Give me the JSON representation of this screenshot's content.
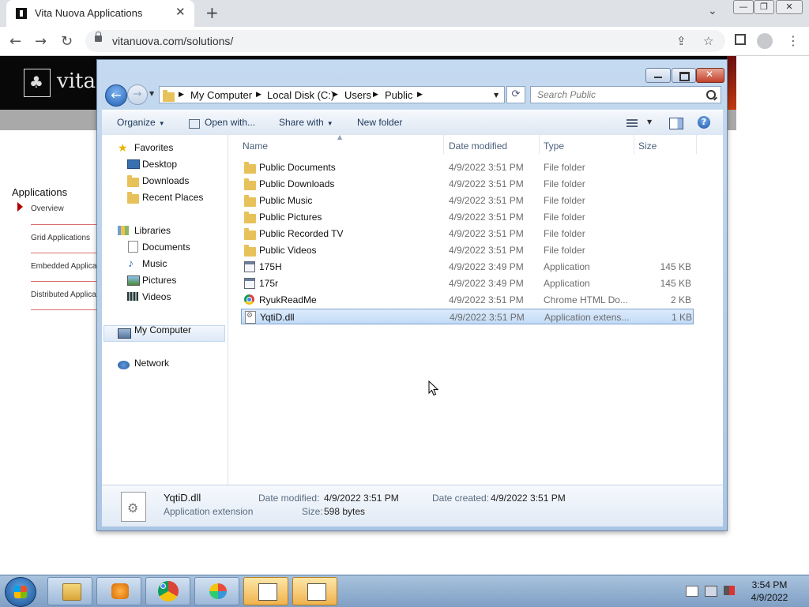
{
  "browser": {
    "tab_title": "Vita Nuova Applications",
    "tab_close": "✕",
    "new_tab": "+",
    "tab_list": "⌄",
    "url": "vitanuova.com/solutions/",
    "back": "←",
    "forward": "→",
    "reload": "↻",
    "share": "⇪",
    "bookmark": "☆",
    "menu": "⋮",
    "win_min": "—",
    "win_restore": "❐",
    "win_close": "✕"
  },
  "website": {
    "site_name": "vita",
    "applications_heading": "Applications",
    "sidebar_links": [
      "Overview",
      "Grid Applications",
      "Embedded Applica",
      "Distributed Applica"
    ]
  },
  "explorer": {
    "breadcrumbs": [
      "My Computer",
      "Local Disk (C:)",
      "Users",
      "Public"
    ],
    "search_placeholder": "Search Public",
    "commands": {
      "organize": "Organize",
      "open_with": "Open with...",
      "share_with": "Share with",
      "new_folder": "New folder"
    },
    "nav": {
      "favorites": "Favorites",
      "favorite_items": [
        "Desktop",
        "Downloads",
        "Recent Places"
      ],
      "libraries": "Libraries",
      "library_items": [
        "Documents",
        "Music",
        "Pictures",
        "Videos"
      ],
      "my_computer": "My Computer",
      "network": "Network"
    },
    "columns": {
      "name": "Name",
      "date": "Date modified",
      "type": "Type",
      "size": "Size"
    },
    "files": [
      {
        "name": "Public Documents",
        "date": "4/9/2022 3:51 PM",
        "type": "File folder",
        "size": "",
        "icon": "folder-icon"
      },
      {
        "name": "Public Downloads",
        "date": "4/9/2022 3:51 PM",
        "type": "File folder",
        "size": "",
        "icon": "folder-icon"
      },
      {
        "name": "Public Music",
        "date": "4/9/2022 3:51 PM",
        "type": "File folder",
        "size": "",
        "icon": "folder-icon"
      },
      {
        "name": "Public Pictures",
        "date": "4/9/2022 3:51 PM",
        "type": "File folder",
        "size": "",
        "icon": "folder-icon"
      },
      {
        "name": "Public Recorded TV",
        "date": "4/9/2022 3:51 PM",
        "type": "File folder",
        "size": "",
        "icon": "folder-icon"
      },
      {
        "name": "Public Videos",
        "date": "4/9/2022 3:51 PM",
        "type": "File folder",
        "size": "",
        "icon": "folder-icon"
      },
      {
        "name": "175H",
        "date": "4/9/2022 3:49 PM",
        "type": "Application",
        "size": "145 KB",
        "icon": "application-icon"
      },
      {
        "name": "175r",
        "date": "4/9/2022 3:49 PM",
        "type": "Application",
        "size": "145 KB",
        "icon": "application-icon"
      },
      {
        "name": "RyukReadMe",
        "date": "4/9/2022 3:51 PM",
        "type": "Chrome HTML Do...",
        "size": "2 KB",
        "icon": "chrome-html-icon"
      },
      {
        "name": "YqtiD.dll",
        "date": "4/9/2022 3:51 PM",
        "type": "Application extens...",
        "size": "1 KB",
        "icon": "dll-icon",
        "selected": true
      }
    ],
    "details": {
      "file_name": "YqtiD.dll",
      "file_type": "Application extension",
      "date_modified_label": "Date modified:",
      "date_modified": "4/9/2022 3:51 PM",
      "size_label": "Size:",
      "size": "598 bytes",
      "date_created_label": "Date created:",
      "date_created": "4/9/2022 3:51 PM"
    }
  },
  "taskbar": {
    "time": "3:54 PM",
    "date": "4/9/2022",
    "buttons": [
      "windows-explorer-icon",
      "media-player-icon",
      "chrome-icon",
      "paint-icon",
      "program-window-icon",
      "program-window-icon"
    ]
  },
  "colors": {
    "explorer_frame": "#b8d0ec",
    "selection": "#c2dbf7",
    "site_header": "#080808",
    "taskbar": "#8fb0d4"
  }
}
